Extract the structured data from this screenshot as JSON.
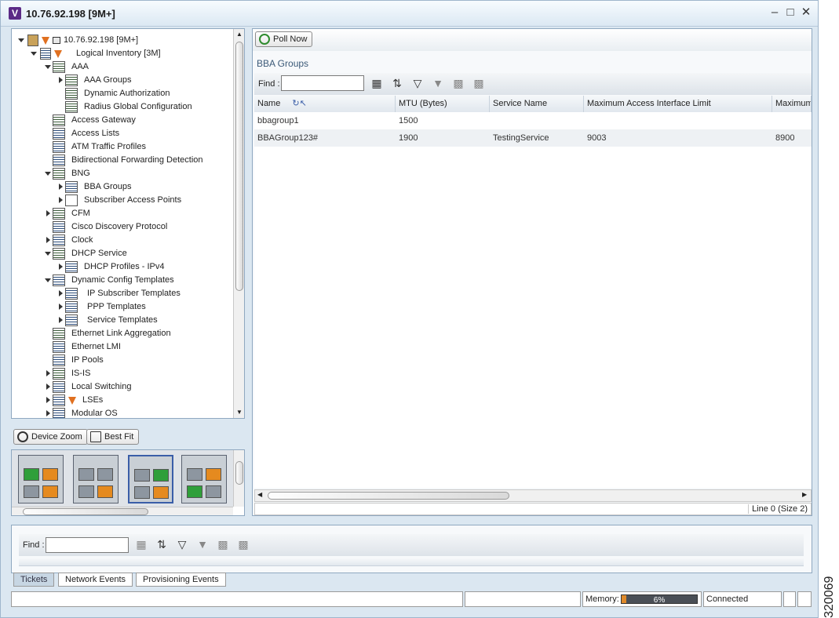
{
  "window": {
    "title": "10.76.92.198 [9M+]",
    "logo": "V",
    "controls": [
      "minimize-icon",
      "maximize-icon",
      "close-icon"
    ]
  },
  "tree": {
    "root": "10.76.92.198 [9M+]",
    "logical": "Logical Inventory [3M]",
    "items": [
      "AAA",
      "AAA Groups",
      "Dynamic Authorization",
      "Radius Global Configuration",
      "Access Gateway",
      "Access Lists",
      "ATM Traffic Profiles",
      "Bidirectional Forwarding Detection",
      "BNG",
      "BBA Groups",
      "Subscriber Access Points",
      "CFM",
      "Cisco Discovery Protocol",
      "Clock",
      "DHCP Service",
      "DHCP Profiles - IPv4",
      "Dynamic Config Templates",
      "IP Subscriber Templates",
      "PPP Templates",
      "Service Templates",
      "Ethernet Link Aggregation",
      "Ethernet LMI",
      "IP Pools",
      "IS-IS",
      "Local Switching",
      "LSEs",
      "Modular OS"
    ]
  },
  "zoom": {
    "device_zoom": "Device Zoom",
    "best_fit": "Best Fit"
  },
  "main": {
    "poll_now": "Poll Now",
    "section_title": "BBA Groups",
    "find_label": "Find :",
    "find_value": "",
    "columns": [
      "Name",
      "MTU (Bytes)",
      "Service Name",
      "Maximum Access Interface Limit",
      "Maximum"
    ],
    "rows": [
      [
        "bbagroup1",
        "1500",
        "",
        "",
        ""
      ],
      [
        "BBAGroup123#",
        "1900",
        "TestingService",
        "9003",
        "8900"
      ]
    ],
    "line_status": "Line 0 (Size 2)"
  },
  "bottom": {
    "find_label": "Find :",
    "find_value": "",
    "tabs": [
      "Tickets",
      "Network Events",
      "Provisioning Events"
    ],
    "active_tab": "Tickets"
  },
  "status": {
    "memory_label": "Memory:",
    "memory_value": "6%",
    "memory_fraction": 0.06,
    "connection": "Connected"
  },
  "figure_number": "320069"
}
